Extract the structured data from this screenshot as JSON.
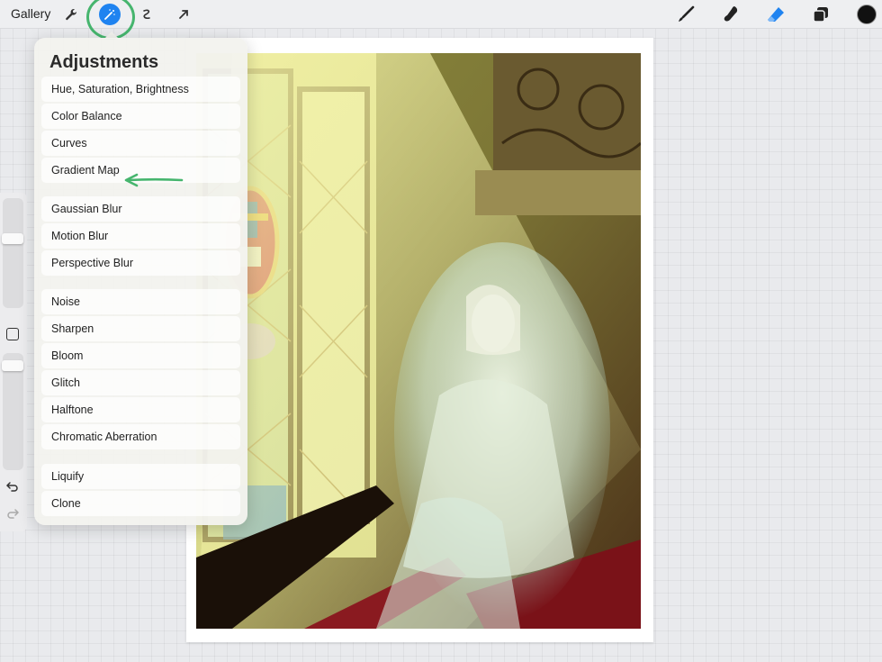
{
  "topbar": {
    "gallery_label": "Gallery",
    "left_tools": [
      "wrench-icon",
      "magic-wand-icon",
      "selection-icon",
      "transform-arrow-icon"
    ],
    "right_tools": [
      "brush-icon",
      "smudge-icon",
      "eraser-icon",
      "layers-icon",
      "color-icon"
    ],
    "active_tool": "magic-wand-icon",
    "accent_color": "#1f83f0",
    "eraser_color": "#1f83f0",
    "current_color": "#111111"
  },
  "adjustments": {
    "title": "Adjustments",
    "groups": [
      [
        "Hue, Saturation, Brightness",
        "Color Balance",
        "Curves",
        "Gradient Map"
      ],
      [
        "Gaussian Blur",
        "Motion Blur",
        "Perspective Blur"
      ],
      [
        "Noise",
        "Sharpen",
        "Bloom",
        "Glitch",
        "Halftone",
        "Chromatic Aberration"
      ],
      [
        "Liquify",
        "Clone"
      ]
    ],
    "highlighted_item": "Curves",
    "annotation_color": "#46b56e"
  },
  "sidebar": {
    "controls": [
      "brush-size-slider",
      "modify-button",
      "brush-opacity-slider",
      "undo-icon",
      "redo-icon"
    ]
  },
  "canvas": {
    "artwork_description": "painting-of-ghostly-bride-in-church"
  }
}
